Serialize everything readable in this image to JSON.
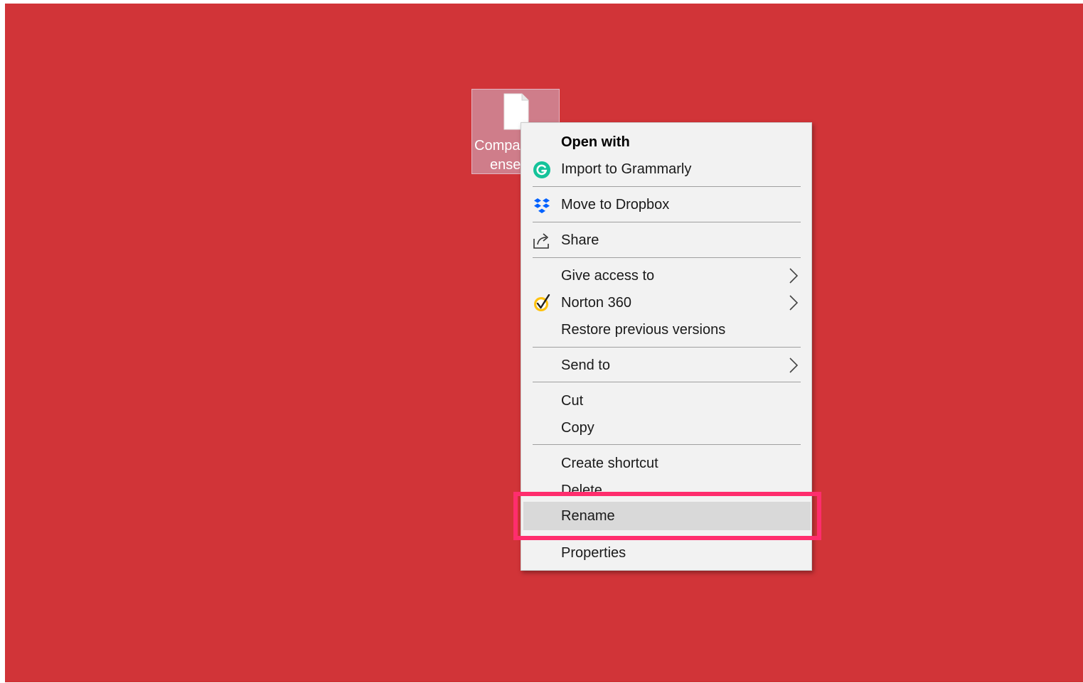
{
  "desktop": {
    "background_color": "#d13438",
    "file": {
      "name_line1": "Compa",
      "name_line2": "ense.",
      "icon": "document-icon"
    }
  },
  "context_menu": {
    "items": [
      {
        "label": "Open with",
        "bold": true,
        "icon": null,
        "submenu": false
      },
      {
        "label": "Import to Grammarly",
        "icon": "grammarly-icon",
        "submenu": false
      },
      {
        "label": "Move to Dropbox",
        "icon": "dropbox-icon",
        "submenu": false
      },
      {
        "label": "Share",
        "icon": "share-icon",
        "submenu": false
      },
      {
        "label": "Give access to",
        "icon": null,
        "submenu": true
      },
      {
        "label": "Norton 360",
        "icon": "norton-icon",
        "submenu": true
      },
      {
        "label": "Restore previous versions",
        "icon": null,
        "submenu": false
      },
      {
        "label": "Send to",
        "icon": null,
        "submenu": true
      },
      {
        "label": "Cut",
        "icon": null,
        "submenu": false
      },
      {
        "label": "Copy",
        "icon": null,
        "submenu": false
      },
      {
        "label": "Create shortcut",
        "icon": null,
        "submenu": false
      },
      {
        "label": "Delete",
        "icon": null,
        "submenu": false
      },
      {
        "label": "Rename",
        "icon": null,
        "submenu": false,
        "highlighted": true
      },
      {
        "label": "Properties",
        "icon": null,
        "submenu": false
      }
    ]
  },
  "annotation": {
    "highlight_color": "#ff2d6d",
    "target": "Rename"
  }
}
